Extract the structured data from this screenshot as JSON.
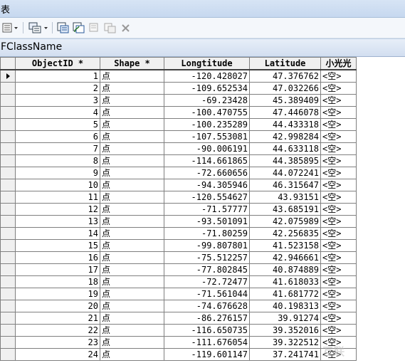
{
  "window": {
    "title": "表"
  },
  "classbar": {
    "name": "FClassName"
  },
  "toolbar": {
    "icons": [
      "table-options-icon",
      "related-tables-icon",
      "select-by-attributes-icon",
      "switch-selection-icon",
      "clear-selection-icon",
      "delete-selected-icon",
      "close-icon"
    ]
  },
  "table": {
    "columns": [
      "ObjectID *",
      "Shape *",
      "Longtitude",
      "Latitude",
      "小光光"
    ],
    "rows": [
      {
        "id": "1",
        "shape": "点",
        "lon": "-120.428027",
        "lat": "47.376762",
        "extra": "<空>"
      },
      {
        "id": "2",
        "shape": "点",
        "lon": "-109.652534",
        "lat": "47.032266",
        "extra": "<空>"
      },
      {
        "id": "3",
        "shape": "点",
        "lon": "-69.23428",
        "lat": "45.389409",
        "extra": "<空>"
      },
      {
        "id": "4",
        "shape": "点",
        "lon": "-100.470755",
        "lat": "47.446078",
        "extra": "<空>"
      },
      {
        "id": "5",
        "shape": "点",
        "lon": "-100.235289",
        "lat": "44.433318",
        "extra": "<空>"
      },
      {
        "id": "6",
        "shape": "点",
        "lon": "-107.553081",
        "lat": "42.998284",
        "extra": "<空>"
      },
      {
        "id": "7",
        "shape": "点",
        "lon": "-90.006191",
        "lat": "44.633118",
        "extra": "<空>"
      },
      {
        "id": "8",
        "shape": "点",
        "lon": "-114.661865",
        "lat": "44.385895",
        "extra": "<空>"
      },
      {
        "id": "9",
        "shape": "点",
        "lon": "-72.660656",
        "lat": "44.072241",
        "extra": "<空>"
      },
      {
        "id": "10",
        "shape": "点",
        "lon": "-94.305946",
        "lat": "46.315647",
        "extra": "<空>"
      },
      {
        "id": "11",
        "shape": "点",
        "lon": "-120.554627",
        "lat": "43.93151",
        "extra": "<空>"
      },
      {
        "id": "12",
        "shape": "点",
        "lon": "-71.57777",
        "lat": "43.685191",
        "extra": "<空>"
      },
      {
        "id": "13",
        "shape": "点",
        "lon": "-93.501091",
        "lat": "42.075989",
        "extra": "<空>"
      },
      {
        "id": "14",
        "shape": "点",
        "lon": "-71.80259",
        "lat": "42.256835",
        "extra": "<空>"
      },
      {
        "id": "15",
        "shape": "点",
        "lon": "-99.807801",
        "lat": "41.523158",
        "extra": "<空>"
      },
      {
        "id": "16",
        "shape": "点",
        "lon": "-75.512257",
        "lat": "42.946661",
        "extra": "<空>"
      },
      {
        "id": "17",
        "shape": "点",
        "lon": "-77.802845",
        "lat": "40.874889",
        "extra": "<空>"
      },
      {
        "id": "18",
        "shape": "点",
        "lon": "-72.72477",
        "lat": "41.618033",
        "extra": "<空>"
      },
      {
        "id": "19",
        "shape": "点",
        "lon": "-71.561044",
        "lat": "41.681772",
        "extra": "<空>"
      },
      {
        "id": "20",
        "shape": "点",
        "lon": "-74.676628",
        "lat": "40.198313",
        "extra": "<空>"
      },
      {
        "id": "21",
        "shape": "点",
        "lon": "-86.276157",
        "lat": "39.91274",
        "extra": "<空>"
      },
      {
        "id": "22",
        "shape": "点",
        "lon": "-116.650735",
        "lat": "39.352016",
        "extra": "<空>"
      },
      {
        "id": "23",
        "shape": "点",
        "lon": "-111.676054",
        "lat": "39.322512",
        "extra": "<空>"
      },
      {
        "id": "24",
        "shape": "点",
        "lon": "-119.601147",
        "lat": "37.241741",
        "extra": "<空>"
      }
    ]
  },
  "watermark": {
    "text": "互联"
  }
}
